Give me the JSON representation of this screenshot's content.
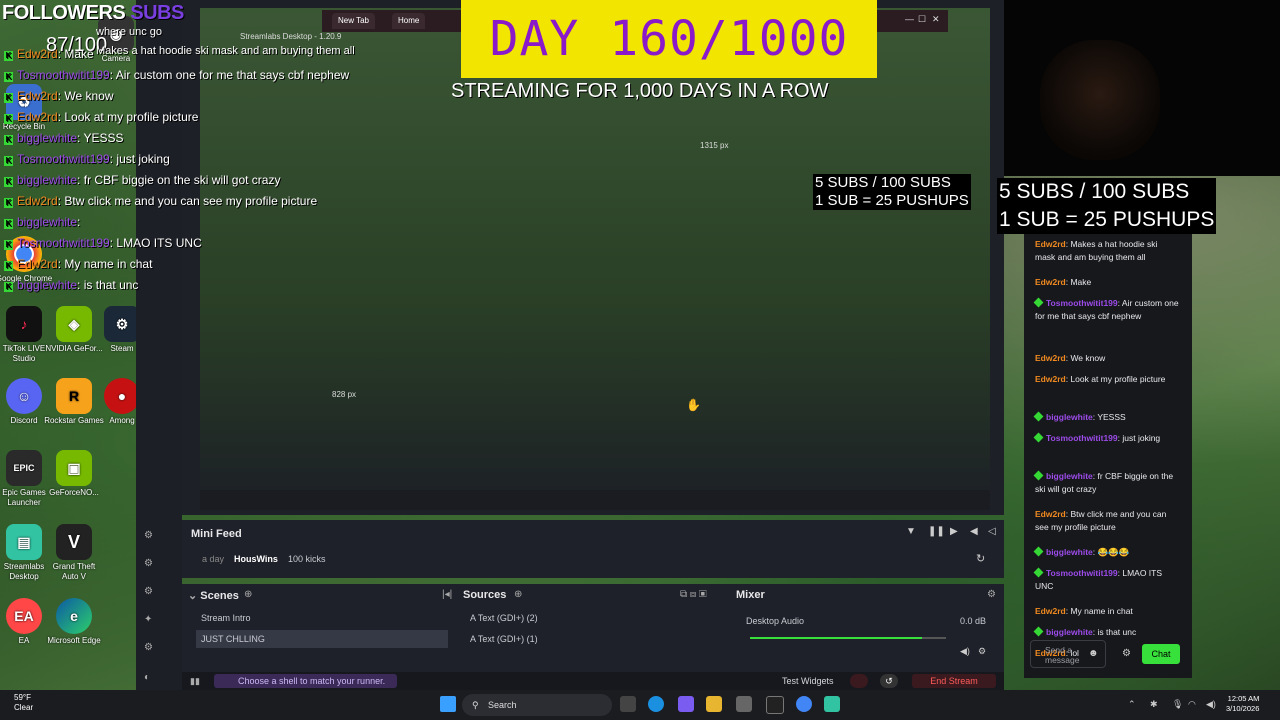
{
  "overlay": {
    "followers_label": "FOLLOWERS",
    "subs_label": "SUBS",
    "count": "87/100",
    "day_counter": "DAY 160/1000",
    "streaming_text": "STREAMING FOR 1,000 DAYS IN A ROW",
    "sub_goal_line1": "5 SUBS / 100 SUBS",
    "sub_goal_line2": "1 SUB = 25 PUSHUPS",
    "px_readout": "1315 px"
  },
  "chat_overlay": [
    {
      "user": "Edw2rd",
      "sep": ":",
      "text": "Make",
      "color": "orange"
    },
    {
      "user": "Tosmoothwitit199",
      "sep": ":",
      "text": "Air custom one for me that says cbf nephew",
      "color": "purple"
    },
    {
      "user": "Edw2rd",
      "sep": ":",
      "text": "We know",
      "color": "orange"
    },
    {
      "user": "Edw2rd",
      "sep": ":",
      "text": "Look at my profile picture",
      "color": "orange"
    },
    {
      "user": "bigglewhite",
      "sep": ":",
      "text": "YESSS",
      "color": "purple"
    },
    {
      "user": "Tosmoothwitit199",
      "sep": ":",
      "text": "just joking",
      "color": "purple"
    },
    {
      "user": "bigglewhite",
      "sep": ":",
      "text": "fr CBF biggie on the ski will got crazy",
      "color": "purple"
    },
    {
      "user": "Edw2rd",
      "sep": ":",
      "text": "Btw click me and you can see my profile picture",
      "color": "orange"
    },
    {
      "user": "bigglewhite",
      "sep": ":",
      "text": "",
      "color": "purple"
    },
    {
      "user": "Tosmoothwitit199",
      "sep": ":",
      "text": "LMAO ITS UNC",
      "color": "purple"
    },
    {
      "user": "Edw2rd",
      "sep": ":",
      "text": "My name in chat",
      "color": "orange"
    },
    {
      "user": "bigglewhite",
      "sep": ":",
      "text": "is that unc",
      "color": "purple"
    }
  ],
  "chat_overlay_top": "where unc go",
  "chat_overlay_top2": "Makes a hat hoodie ski mask and am buying them all",
  "desktop_icons": [
    {
      "label": "Recycle Bin"
    },
    {
      "label": "Camera"
    },
    {
      "label": "Google Chrome"
    },
    {
      "label": "TikTok LIVE Studio"
    },
    {
      "label": "NVIDIA GeFor..."
    },
    {
      "label": "Steam"
    },
    {
      "label": "Discord"
    },
    {
      "label": "Rockstar Games"
    },
    {
      "label": "Among"
    },
    {
      "label": "Epic Games Launcher"
    },
    {
      "label": "GeForceNO..."
    },
    {
      "label": "Streamlabs Desktop"
    },
    {
      "label": "Grand Theft Auto V"
    },
    {
      "label": "EA"
    },
    {
      "label": "Microsoft Edge"
    }
  ],
  "obs": {
    "window_title": "Streamlabs Desktop - 1.20.9",
    "browser_tabs": [
      "New Tab",
      "Home"
    ],
    "minifeed": {
      "title": "Mini Feed",
      "time": "a day",
      "user": "HousWins",
      "event": "100 kicks"
    },
    "scenes": {
      "title": "Scenes",
      "items": [
        "Stream Intro",
        "JUST CHLLING"
      ]
    },
    "sources": {
      "title": "Sources",
      "items": [
        "Text (GDI+) (2)",
        "Text (GDI+) (1)"
      ]
    },
    "mixer": {
      "title": "Mixer",
      "channel": "Desktop Audio",
      "level": "0.0 dB",
      "volume_fraction": 0.88
    },
    "shell_prompt": "Choose a shell to match your runner.",
    "test_widgets": "Test Widgets",
    "end_stream": "End Stream",
    "nested_px": "828 px"
  },
  "chat_panel": {
    "messages": [
      {
        "user": "Edw2rd",
        "text": "Makes a hat hoodie ski mask and am buying them all",
        "color": "orange",
        "badge": false
      },
      {
        "user": "Edw2rd",
        "text": "Make",
        "color": "orange",
        "badge": false
      },
      {
        "user": "Tosmoothwitit199",
        "text": "Air custom one for me that says cbf nephew",
        "color": "purple",
        "badge": true
      },
      {
        "user": "Edw2rd",
        "text": "We know",
        "color": "orange",
        "badge": false
      },
      {
        "user": "Edw2rd",
        "text": "Look at my profile picture",
        "color": "orange",
        "badge": false
      },
      {
        "user": "bigglewhite",
        "text": "YESSS",
        "color": "purple",
        "badge": true
      },
      {
        "user": "Tosmoothwitit199",
        "text": "just joking",
        "color": "purple",
        "badge": true
      },
      {
        "user": "bigglewhite",
        "text": "fr CBF biggie on the ski will got crazy",
        "color": "purple",
        "badge": true
      },
      {
        "user": "Edw2rd",
        "text": "Btw click me and you can see my profile picture",
        "color": "orange",
        "badge": false
      },
      {
        "user": "bigglewhite",
        "text": "😂😂😂",
        "color": "purple",
        "badge": true
      },
      {
        "user": "Tosmoothwitit199",
        "text": "LMAO ITS UNC",
        "color": "purple",
        "badge": true
      },
      {
        "user": "Edw2rd",
        "text": "My name in chat",
        "color": "orange",
        "badge": false
      },
      {
        "user": "bigglewhite",
        "text": "is that unc",
        "color": "purple",
        "badge": true
      },
      {
        "user": "Edw2rd",
        "text": "lol",
        "color": "orange",
        "badge": false
      }
    ],
    "send_placeholder": "Send a message",
    "chat_button": "Chat"
  },
  "taskbar": {
    "weather_temp": "59°F",
    "weather_desc": "Clear",
    "search": "Search",
    "time": "12:05 AM",
    "date": "3/10/2026"
  },
  "colors": {
    "accent_green": "#37e03a",
    "day_yellow": "#f2e600",
    "day_purple": "#8a1ac9",
    "user_orange": "#f08a20",
    "user_purple": "#9b4be8"
  }
}
